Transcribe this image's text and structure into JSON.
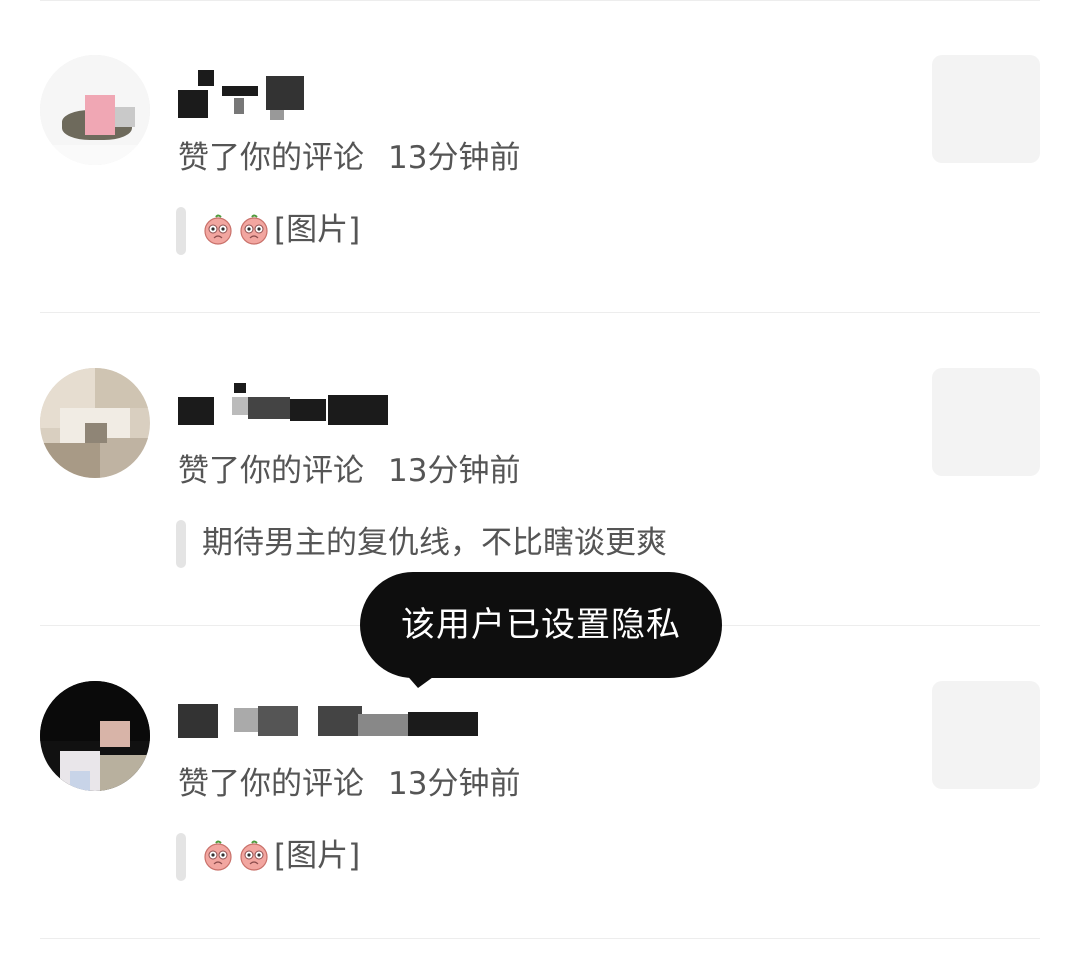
{
  "notifications": [
    {
      "action": "赞了你的评论",
      "time": "13分钟前",
      "content_text": "[图片]",
      "has_emoji": true
    },
    {
      "action": "赞了你的评论",
      "time": "13分钟前",
      "content_text": "期待男主的复仇线，不比瞎谈更爽",
      "has_emoji": false
    },
    {
      "action": "赞了你的评论",
      "time": "13分钟前",
      "content_text": "[图片]",
      "has_emoji": true
    }
  ],
  "toast": {
    "message": "该用户已设置隐私"
  },
  "icons": {
    "emoji": "peach-face-emoji"
  },
  "colors": {
    "meta_text": "#555555",
    "divider": "#ededed",
    "thumb_bg": "#f3f3f3",
    "toast_bg": "#0e0e0e"
  }
}
